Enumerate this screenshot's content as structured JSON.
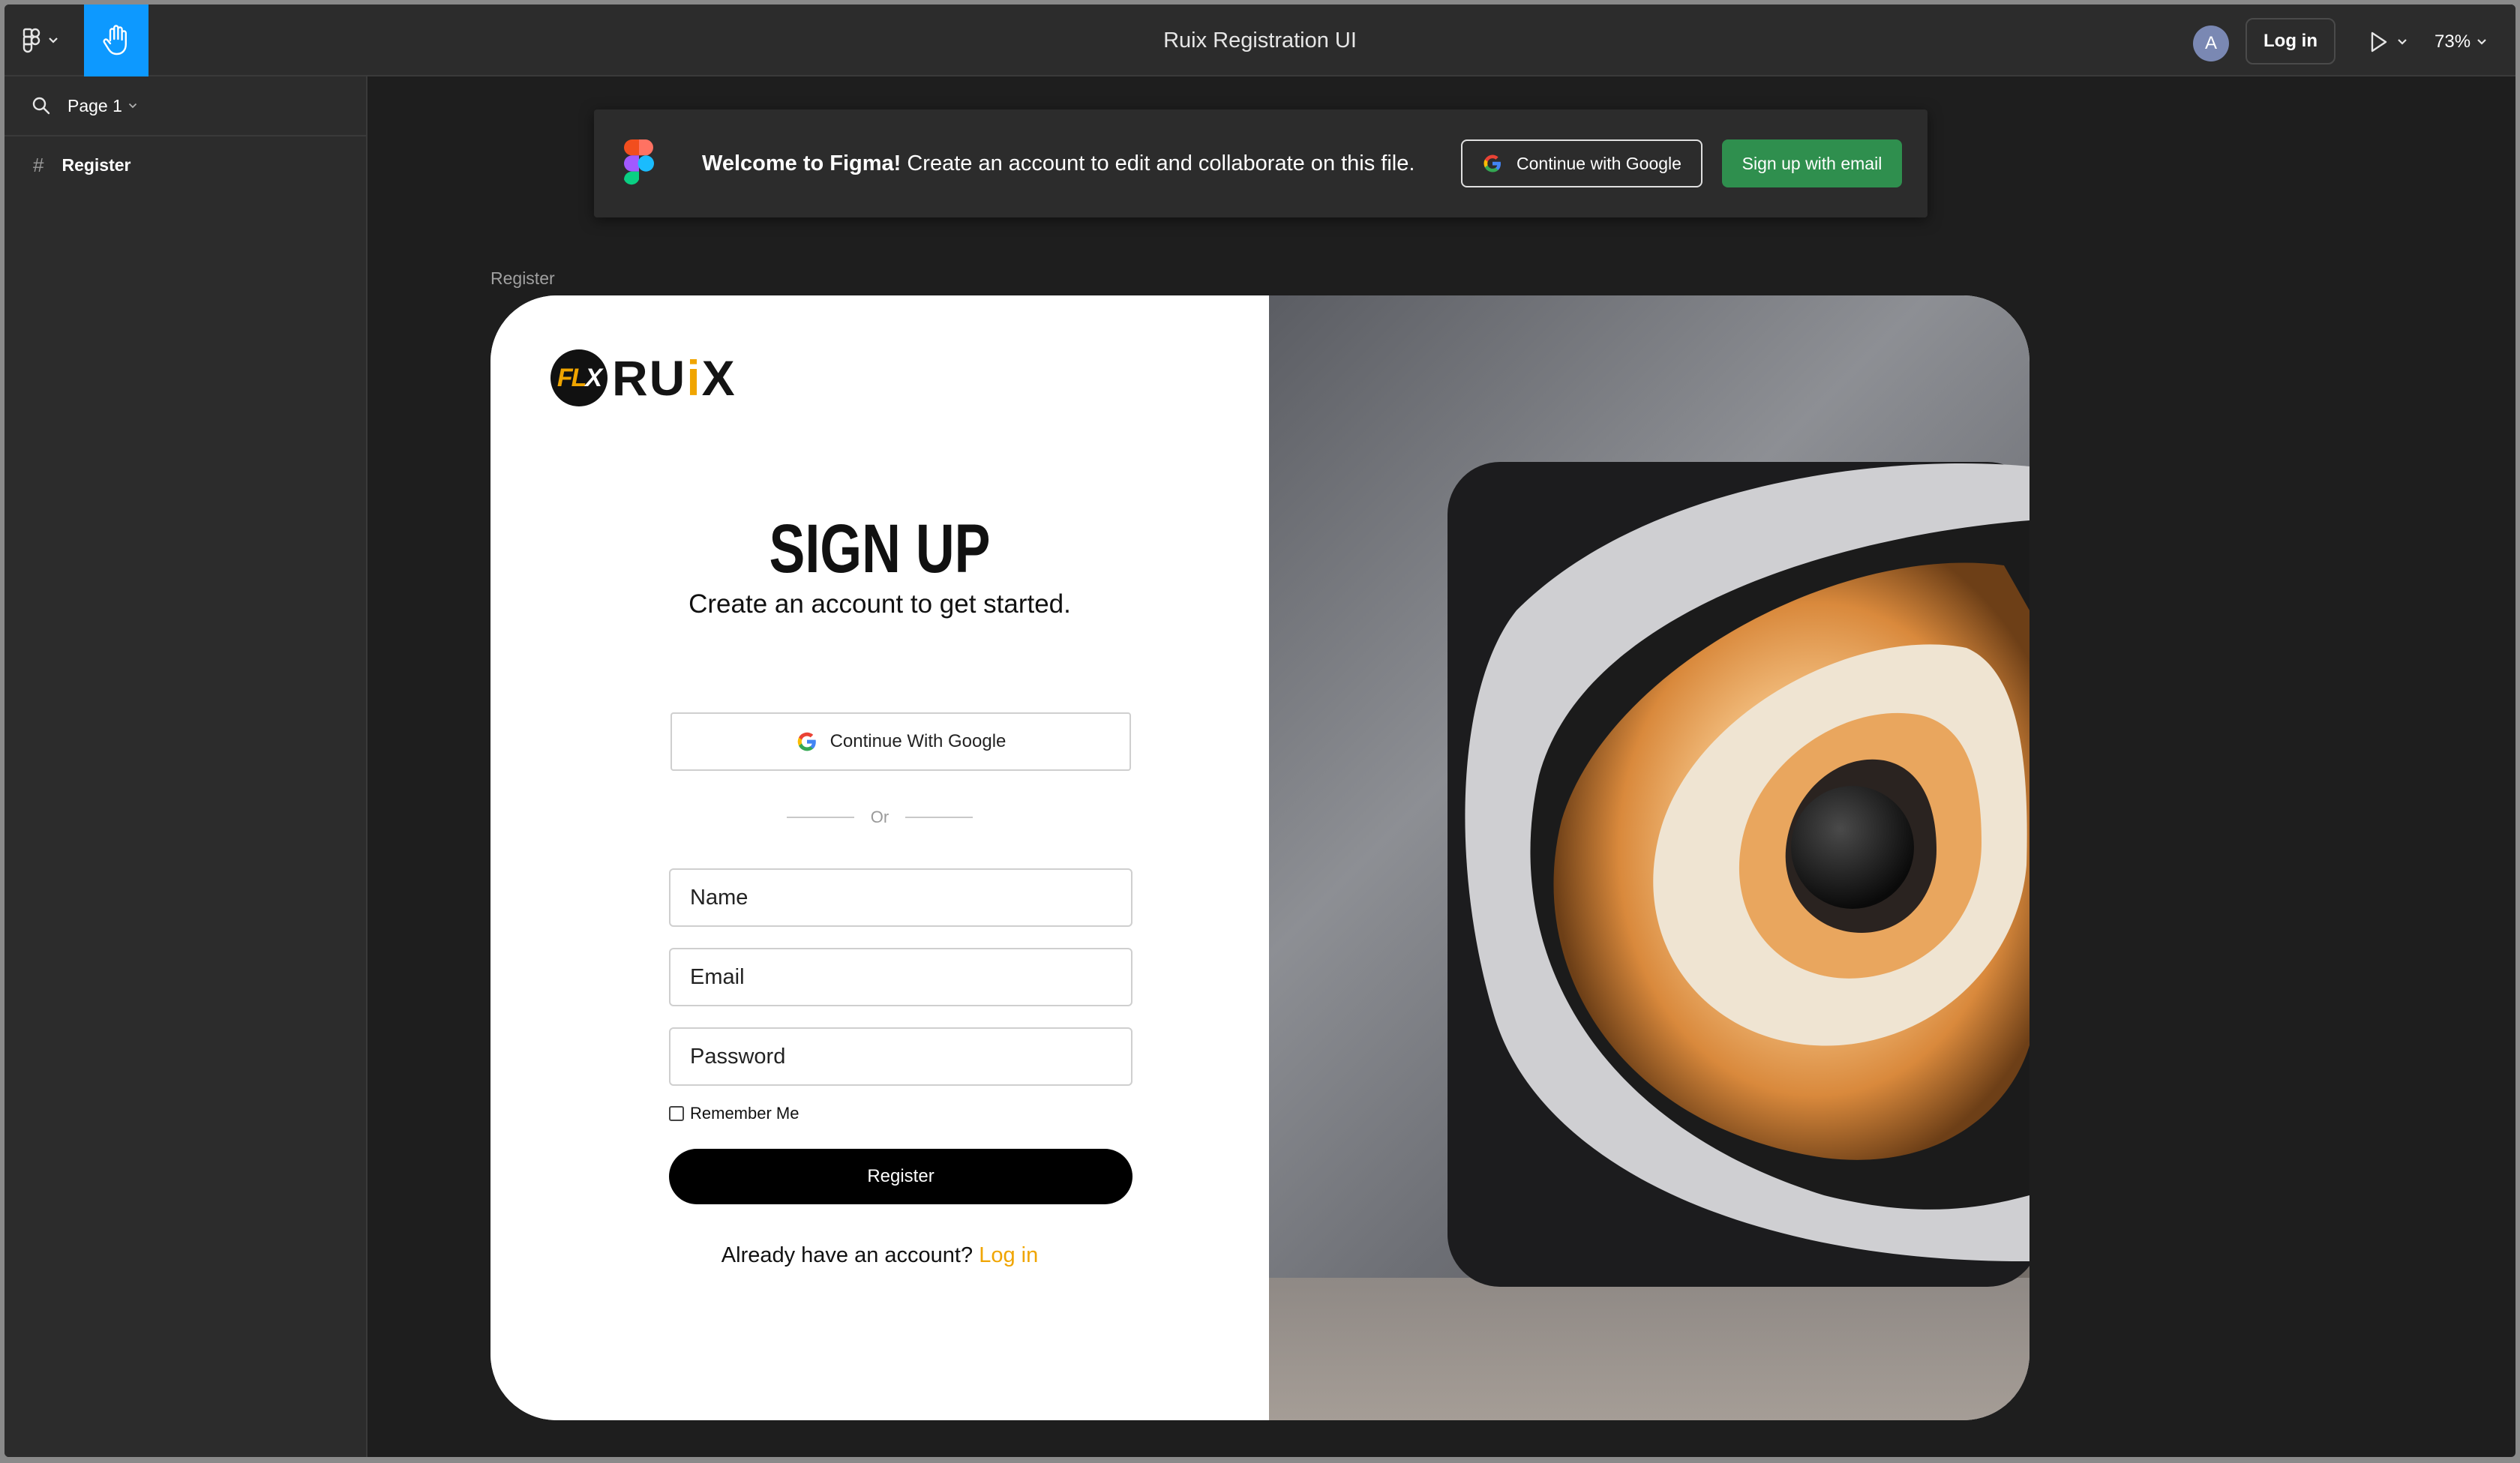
{
  "app": {
    "title": "Ruix Registration UI",
    "avatar_initial": "A",
    "login_label": "Log in",
    "zoom": "73%"
  },
  "sidebar": {
    "page_label": "Page 1",
    "layers": [
      {
        "label": "Register"
      }
    ]
  },
  "banner": {
    "bold_text": "Welcome to Figma!",
    "text": "Create an account to edit and collaborate on this file.",
    "google_label": "Continue with Google",
    "email_label": "Sign up with email"
  },
  "frame": {
    "label": "Register"
  },
  "form": {
    "brand_mark_a": "FL",
    "brand_mark_b": "X",
    "brand_word_a": "RU",
    "brand_word_b": "i",
    "brand_word_c": "X",
    "title": "SIGN UP",
    "subtitle": "Create an account to get started.",
    "google_label": "Continue With Google",
    "divider_text": "Or",
    "name_placeholder": "Name",
    "email_placeholder": "Email",
    "password_placeholder": "Password",
    "remember_label": "Remember Me",
    "register_label": "Register",
    "have_account_text": "Already have an account?",
    "login_link": "Log in"
  },
  "colors": {
    "accent_blue": "#0d99ff",
    "brand_yellow": "#f0a500",
    "signup_green": "#2f8f4e"
  }
}
